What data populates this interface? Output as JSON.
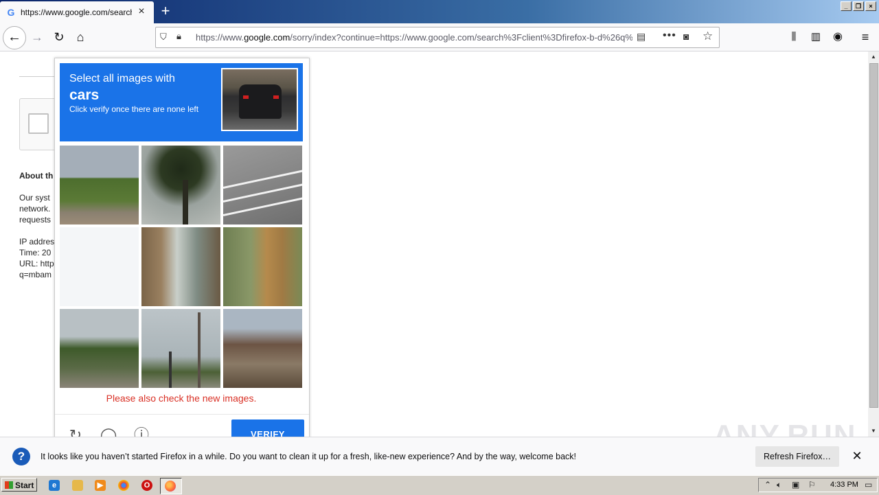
{
  "browser": {
    "tab_title": "https://www.google.com/search?c",
    "tab_favicon": "G",
    "url_prefix": "https://www.",
    "url_domain": "google.com",
    "url_rest": "/sorry/index?continue=https://www.google.com/search%3Fclient%3Dfirefox-b-d%26q%3Dm",
    "icons": [
      "back-icon",
      "forward-icon",
      "reload-icon",
      "home-icon",
      "shield-icon",
      "lock-icon",
      "reader-icon",
      "more-icon",
      "pocket-icon",
      "bookmark-star-icon",
      "library-icon",
      "sidebar-icon",
      "account-icon",
      "menu-icon"
    ]
  },
  "page": {
    "about_heading": "About th",
    "lines": [
      "Our syst",
      "network.",
      "requests",
      "IP addres",
      "Time: 20",
      "URL: http",
      "q=mbam"
    ]
  },
  "captcha": {
    "line1": "Select all images with",
    "target": "cars",
    "line3": "Click verify once there are none left",
    "error": "Please also check the new images.",
    "verify_label": "VERIFY",
    "accent": "#1a73e8",
    "error_color": "#d93025",
    "tiles": [
      "hills-with-trees",
      "palm-tree",
      "road-crosswalk",
      "blank-loading",
      "glass-door",
      "fire-hydrant",
      "trees-and-dirt",
      "traffic-light-pole",
      "house-roof"
    ]
  },
  "notification": {
    "message": "It looks like you haven’t started Firefox in a while. Do you want to clean it up for a fresh, like-new experience? And by the way, welcome back!",
    "refresh_label": "Refresh Firefox…",
    "close_label": "✕"
  },
  "watermark": "ANY.RUN",
  "taskbar": {
    "start_label": "Start",
    "time": "4:33 PM"
  }
}
